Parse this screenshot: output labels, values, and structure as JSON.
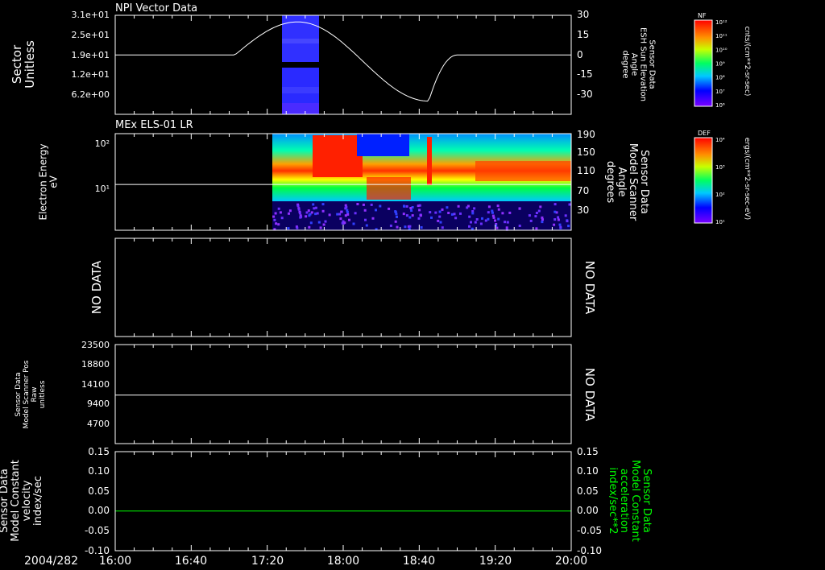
{
  "date_label": "2004/282",
  "time_ticks": [
    "16:00",
    "16:40",
    "17:20",
    "18:00",
    "18:40",
    "19:20",
    "20:00"
  ],
  "chart_data": [
    {
      "type": "heatmap",
      "title": "NPI Vector Data",
      "ylabel": "Sector\nUnitless",
      "y_ticks": [
        "3.1e+01",
        "2.5e+01",
        "1.9e+01",
        "1.2e+01",
        "6.2e+00"
      ],
      "right_ylabel": "Sensor Data\nESH Sun Elevation\nAngle\ndegree",
      "right_ticks": [
        "30",
        "15",
        "0",
        "-15",
        "-30"
      ],
      "right_ylim": [
        -45,
        30
      ],
      "data_window": [
        "17:32",
        "18:02"
      ],
      "line_series": {
        "time_hours_start": 16.0,
        "flat_value": 0,
        "peak": {
          "time": "17:35",
          "value": 25
        },
        "trough": {
          "time": "18:45",
          "value": -35
        }
      },
      "colorbar": {
        "label": "NF",
        "units": "cnts/(cm**2-sr-sec)",
        "ticks": [
          "10¹²",
          "10¹¹",
          "10¹⁰",
          "10⁹",
          "10⁸",
          "10⁷",
          "10⁶"
        ]
      }
    },
    {
      "type": "heatmap",
      "title": "MEx ELS-01 LR",
      "ylabel": "Electron Energy\neV",
      "y_ticks": [
        "10²",
        "10¹"
      ],
      "right_ylabel": "Sensor Data\nModel Scanner\nAngle\ndegrees",
      "right_ticks": [
        "190",
        "150",
        "110",
        "70",
        "30"
      ],
      "right_ylim": [
        0,
        190
      ],
      "line_value": 90,
      "data_window": [
        "17:25",
        "20:00"
      ],
      "colorbar": {
        "label": "DEF",
        "units": "ergs/(cm**2-sr-sec-eV)",
        "ticks": [
          "10⁴",
          "10³",
          "10²",
          "10¹"
        ]
      }
    },
    {
      "type": "line",
      "left_text": "NO DATA",
      "right_text": "NO DATA"
    },
    {
      "type": "line",
      "ylabel": "Sensor Data\nModel Scanner Pos\nRaw\nunitless",
      "y_ticks": [
        "23500",
        "18800",
        "14100",
        "9400",
        "4700"
      ],
      "ylim": [
        0,
        23500
      ],
      "line_value": 11500,
      "right_text": "NO DATA"
    },
    {
      "type": "line",
      "ylabel": "Sensor Data\nModel Constant\nvelocity\nindex/sec",
      "y_ticks": [
        "0.15",
        "0.10",
        "0.05",
        "0.00",
        "-0.05",
        "-0.10"
      ],
      "ylim": [
        -0.1,
        0.15
      ],
      "right_ylabel": "Sensor Data\nModel Constant\nacceleration\nindex/sec**2",
      "right_ticks": [
        "0.15",
        "0.10",
        "0.05",
        "0.00",
        "-0.05",
        "-0.10"
      ],
      "line_value": 0.0,
      "line_color": "#00ff00"
    }
  ]
}
